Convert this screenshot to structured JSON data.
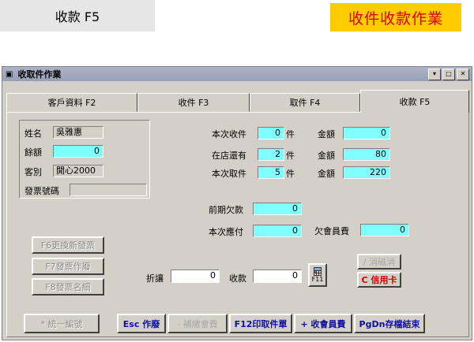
{
  "header": {
    "left_tab": "收款 F5",
    "banner": "收件收款作業"
  },
  "window": {
    "title": "收取件作業",
    "buttons": [
      "▾",
      "□",
      "✕"
    ]
  },
  "tabs": [
    "客戶資料 F2",
    "收件 F3",
    "取件 F4",
    "收款 F5"
  ],
  "customer": {
    "name_label": "姓名",
    "name": "吳雅惠",
    "balance_label": "餘額",
    "balance": "0",
    "type_label": "客別",
    "type": "開心2000",
    "invoice_label": "發票號碼",
    "invoice": ""
  },
  "summary": {
    "rows": [
      {
        "label": "本次收件",
        "count": "0",
        "unit": "件",
        "amount_label": "金額",
        "amount": "0"
      },
      {
        "label": "在店還有",
        "count": "2",
        "unit": "件",
        "amount_label": "金額",
        "amount": "80"
      },
      {
        "label": "本次取件",
        "count": "5",
        "unit": "件",
        "amount_label": "金額",
        "amount": "220"
      }
    ],
    "prev_debt_label": "前期欠款",
    "prev_debt": "0",
    "due_label": "本次應付",
    "due": "0",
    "member_fee_label": "欠會員費",
    "member_fee": "0"
  },
  "left_buttons": [
    "F6更換新發票",
    "F7發票作廢",
    "F8發票名細"
  ],
  "payment": {
    "discount_label": "折讓",
    "discount": "0",
    "receive_label": "收款",
    "receive": "0",
    "f11_label": "F11"
  },
  "right_buttons": {
    "top": "/ 消磁消",
    "credit": "C 信用卡"
  },
  "bottom_buttons": [
    "* 統一編號",
    "Esc 作廢",
    "- 補繳會費",
    "F12印取件單",
    "+ 收會員費",
    "PgDn存檔結束"
  ]
}
